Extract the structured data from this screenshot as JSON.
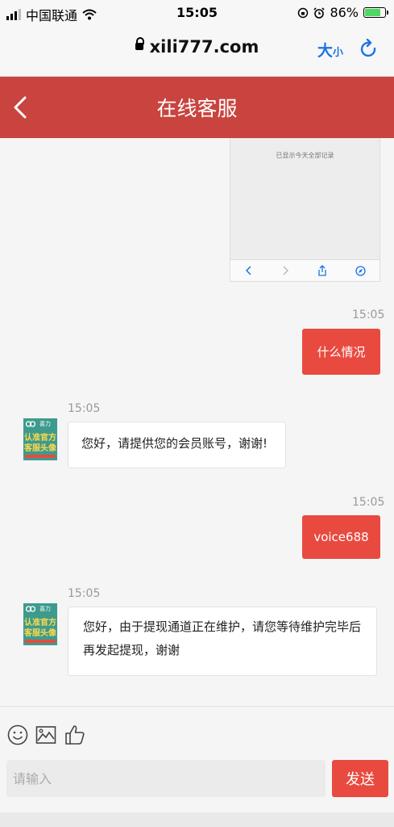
{
  "status_bar": {
    "carrier": "中国联通",
    "time": "15:05",
    "battery": "86%",
    "battery_level": 0.86
  },
  "browser": {
    "url": "xili777.com",
    "text_size_big": "大",
    "text_size_small": "小"
  },
  "header": {
    "title": "在线客服"
  },
  "screenshot_message": {
    "caption": "已显示今天全部记录"
  },
  "messages": [
    {
      "direction": "out",
      "time": "15:05",
      "text": "什么情况"
    },
    {
      "direction": "in",
      "time": "15:05",
      "text": "您好，请提供您的会员账号，谢谢!"
    },
    {
      "direction": "out",
      "time": "15:05",
      "text": "voice688"
    },
    {
      "direction": "in",
      "time": "15:05",
      "text": "您好，由于提现通道正在维护，请您等待维护完毕后再发起提现，谢谢"
    }
  ],
  "avatar": {
    "brand": "喜力",
    "line1": "认准官方",
    "line2": "客服头像"
  },
  "composer": {
    "placeholder": "请输入",
    "send_label": "发送"
  },
  "colors": {
    "header": "#c9443f",
    "accent": "#e94a3f",
    "link": "#1a73e8"
  }
}
